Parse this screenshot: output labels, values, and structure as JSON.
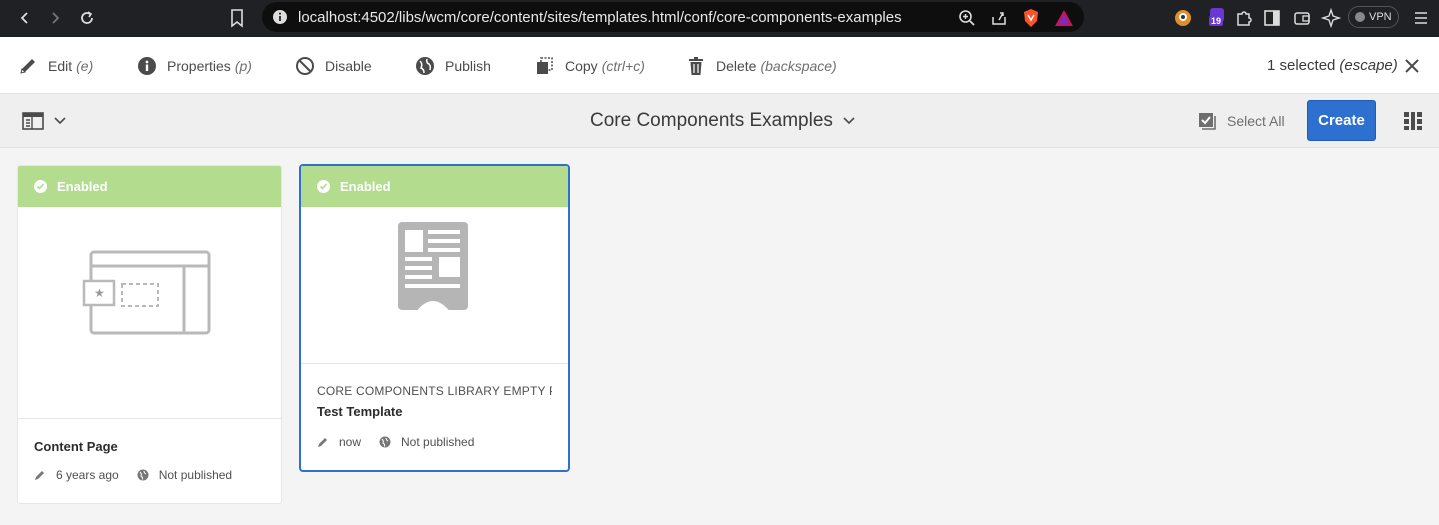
{
  "browser": {
    "url": "localhost:4502/libs/wcm/core/content/sites/templates.html/conf/core-components-examples",
    "vpn_label": "VPN",
    "badge_count": "19"
  },
  "actionbar": {
    "edit": {
      "label": "Edit",
      "shortcut": "(e)"
    },
    "properties": {
      "label": "Properties",
      "shortcut": "(p)"
    },
    "disable": {
      "label": "Disable"
    },
    "publish": {
      "label": "Publish"
    },
    "copy": {
      "label": "Copy",
      "shortcut": "(ctrl+c)"
    },
    "delete": {
      "label": "Delete",
      "shortcut": "(backspace)"
    },
    "selection": {
      "label": "1 selected",
      "shortcut": "(escape)"
    }
  },
  "titlebar": {
    "title": "Core Components Examples",
    "select_all": "Select All",
    "create": "Create"
  },
  "cards": [
    {
      "status": "Enabled",
      "subtitle": "",
      "title": "Content Page",
      "modified": "6 years ago",
      "published": "Not published",
      "selected": false
    },
    {
      "status": "Enabled",
      "subtitle": "CORE COMPONENTS LIBRARY EMPTY P...",
      "title": "Test Template",
      "modified": "now",
      "published": "Not published",
      "selected": true
    }
  ],
  "colors": {
    "status_enabled": "#b3dc8f",
    "accent": "#2d70d0"
  }
}
